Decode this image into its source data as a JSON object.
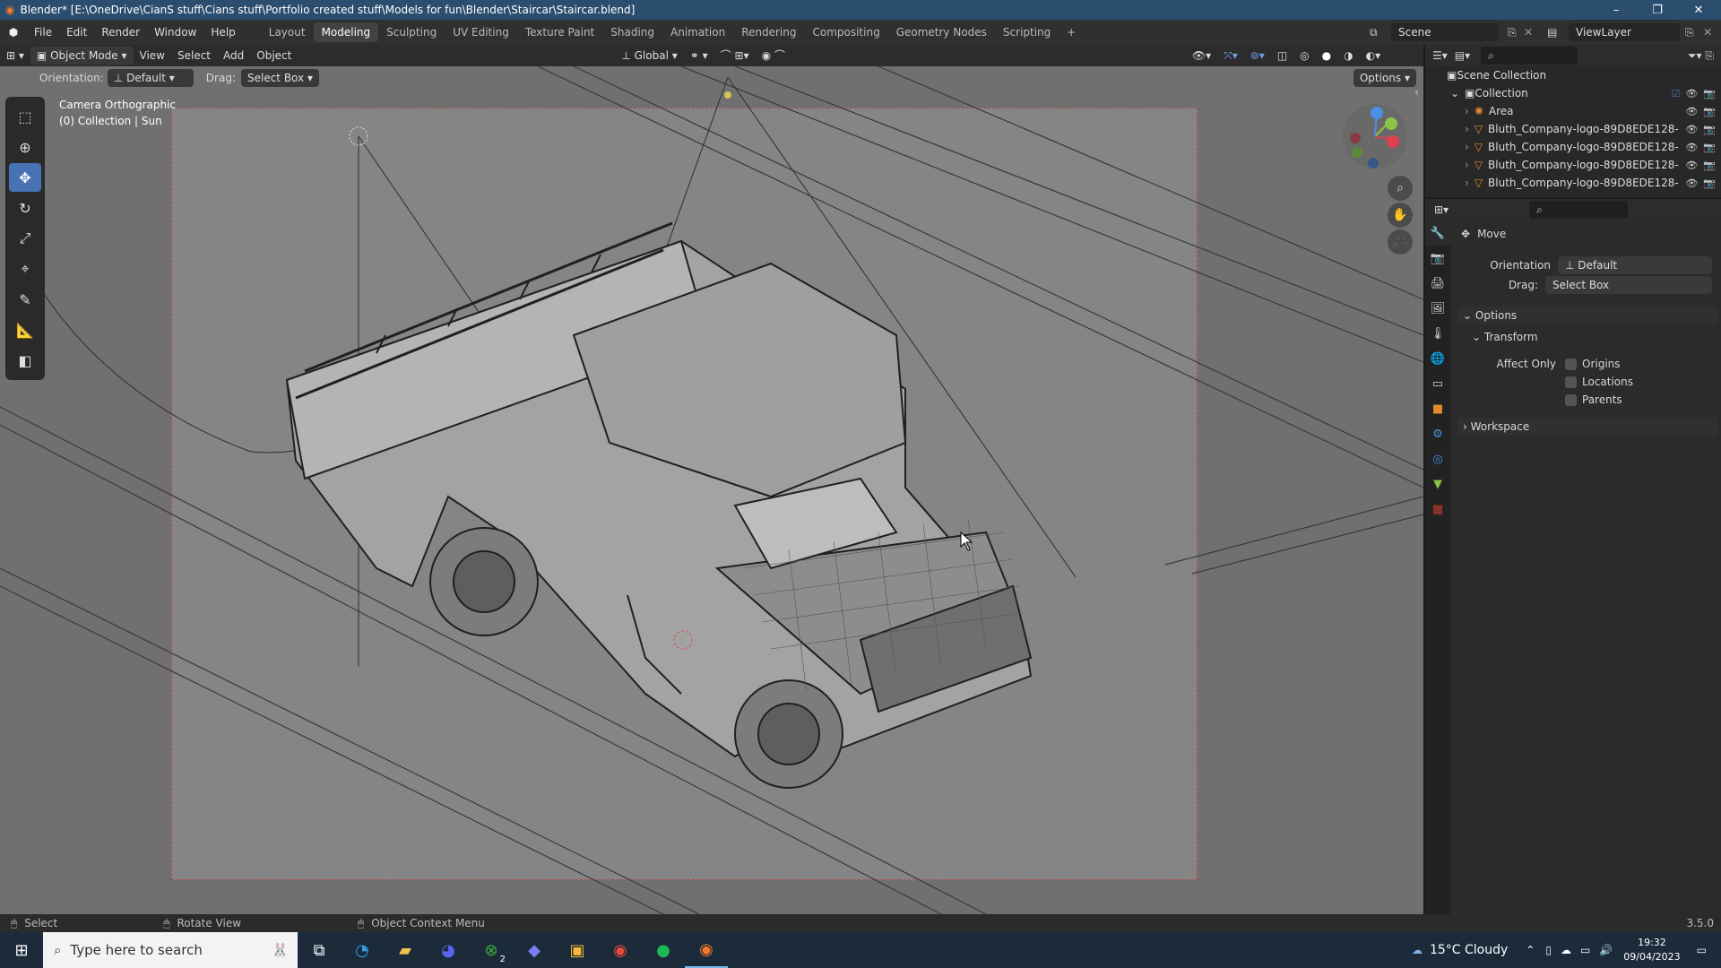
{
  "titlebar": {
    "title": "Blender* [E:\\OneDrive\\CianS stuff\\Cians stuff\\Portfolio created stuff\\Models for fun\\Blender\\Staircar\\Staircar.blend]",
    "minimize": "–",
    "maximize": "❐",
    "close": "✕"
  },
  "menu": {
    "file": "File",
    "edit": "Edit",
    "render": "Render",
    "window": "Window",
    "help": "Help"
  },
  "workspaces": [
    "Layout",
    "Modeling",
    "Sculpting",
    "UV Editing",
    "Texture Paint",
    "Shading",
    "Animation",
    "Rendering",
    "Compositing",
    "Geometry Nodes",
    "Scripting"
  ],
  "active_workspace": "Modeling",
  "scene": {
    "label": "Scene",
    "viewlayer": "ViewLayer"
  },
  "header": {
    "mode": "Object Mode",
    "view": "View",
    "select": "Select",
    "add": "Add",
    "object": "Object",
    "transform_orientation": "Global"
  },
  "toolheader": {
    "orientation_label": "Orientation:",
    "orientation_value": "Default",
    "drag_label": "Drag:",
    "drag_value": "Select Box",
    "options": "Options"
  },
  "viewport": {
    "camera_label": "Camera Orthographic",
    "collection_label": "(0) Collection | Sun"
  },
  "outliner": {
    "root": "Scene Collection",
    "collection": "Collection",
    "items": [
      "Area",
      "Bluth_Company-logo-89D8EDE128-",
      "Bluth_Company-logo-89D8EDE128-",
      "Bluth_Company-logo-89D8EDE128-",
      "Bluth_Company-logo-89D8EDE128-"
    ]
  },
  "properties": {
    "tool_name": "Move",
    "orientation_label": "Orientation",
    "orientation_value": "Default",
    "drag_label": "Drag:",
    "drag_value": "Select Box",
    "options_section": "Options",
    "transform_section": "Transform",
    "affect_only_label": "Affect Only",
    "origins": "Origins",
    "locations": "Locations",
    "parents": "Parents",
    "workspace_section": "Workspace"
  },
  "statusbar": {
    "select": "Select",
    "rotate": "Rotate View",
    "context": "Object Context Menu",
    "version": "3.5.0"
  },
  "taskbar": {
    "search_placeholder": "Type here to search",
    "weather": "15°C  Cloudy",
    "time": "19:32",
    "date": "09/04/2023",
    "xbox_badge": "2"
  },
  "colors": {
    "accent": "#4772b3",
    "titlebar": "#2b4d6e",
    "viewport": "#707070",
    "camera_frame": "#858585",
    "gizmo_x": "#e0414f",
    "gizmo_y": "#8bc34a",
    "gizmo_z": "#4b8ee6"
  }
}
